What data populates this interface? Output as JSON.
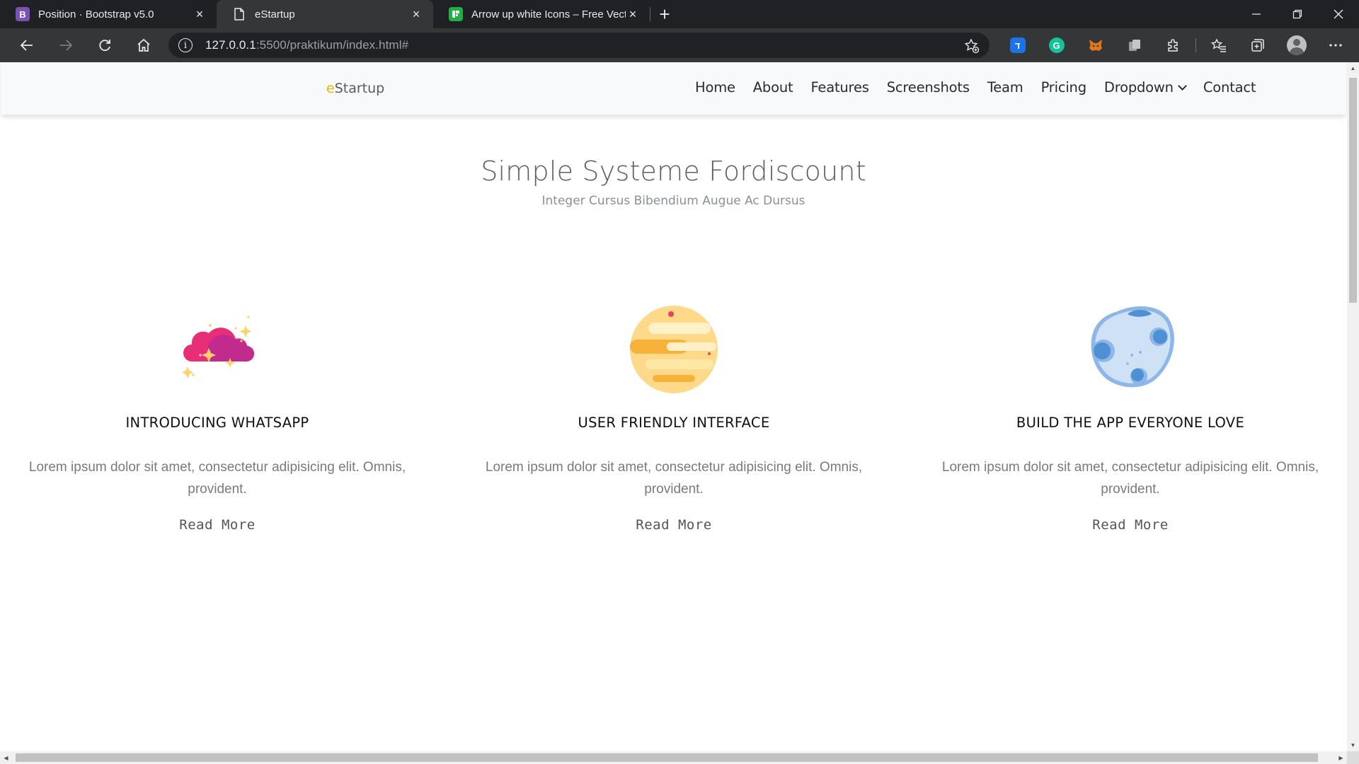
{
  "browser": {
    "tabs": [
      {
        "title": "Position · Bootstrap v5.0",
        "icon": "bootstrap-icon",
        "icon_color": "#7952b3",
        "active": false
      },
      {
        "title": "eStartup",
        "icon": "document-icon",
        "active": true
      },
      {
        "title": "Arrow up white Icons – Free Vect",
        "icon": "flaticon-icon",
        "icon_color": "#1fb141",
        "active": false
      }
    ],
    "url_host": "127.0.0.1",
    "url_rest": ":5500/praktikum/index.html#",
    "extensions": [
      {
        "name": "translate-extension-icon",
        "color": "#1a73e8"
      },
      {
        "name": "grammarly-extension-icon",
        "color": "#15c39a"
      },
      {
        "name": "metamask-extension-icon",
        "color": "#e2761b"
      },
      {
        "name": "copy-extension-icon",
        "color": "#9aa0a6"
      }
    ]
  },
  "site": {
    "brand_e": "e",
    "brand_rest": "Startup",
    "nav": [
      "Home",
      "About",
      "Features",
      "Screenshots",
      "Team",
      "Pricing",
      "Dropdown",
      "Contact"
    ]
  },
  "hero": {
    "title": "Simple Systeme Fordiscount",
    "subtitle": "Integer Cursus Bibendium Augue Ac Dursus"
  },
  "features": [
    {
      "icon": "cloud-stars-icon",
      "title": "INTRODUCING WHATSAPP",
      "text": "Lorem ipsum dolor sit amet, consectetur adipisicing elit. Omnis, provident.",
      "link": "Read More"
    },
    {
      "icon": "planet-icon",
      "title": "USER FRIENDLY INTERFACE",
      "text": "Lorem ipsum dolor sit amet, consectetur adipisicing elit. Omnis, provident.",
      "link": "Read More"
    },
    {
      "icon": "moon-icon",
      "title": "BUILD THE APP EVERYONE LOVE",
      "text": "Lorem ipsum dolor sit amet, consectetur adipisicing elit. Omnis, provident.",
      "link": "Read More"
    }
  ]
}
